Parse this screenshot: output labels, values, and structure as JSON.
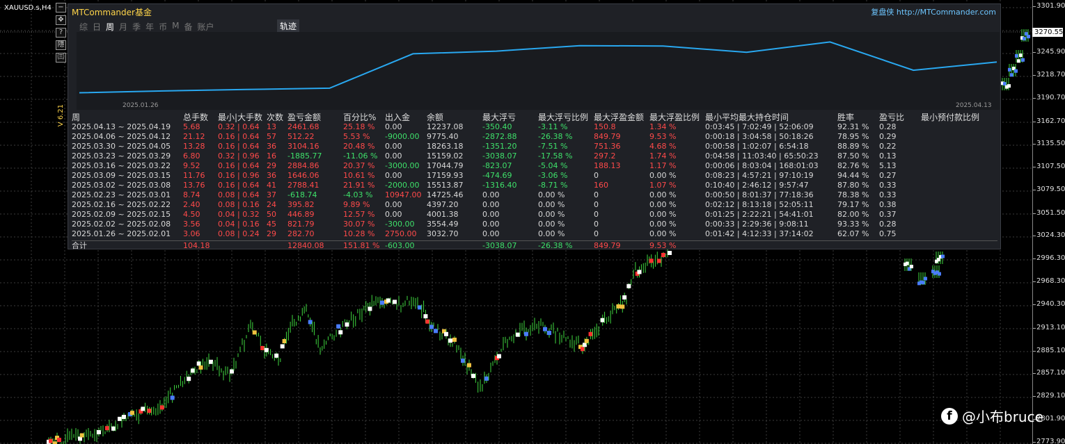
{
  "window": {
    "symbol": "XAUUSD.s,H4"
  },
  "price_axis": {
    "current_price": "3270.55",
    "ticks": [
      "3301.90",
      "3270.55",
      "3245.90",
      "3218.70",
      "3190.70",
      "3162.70",
      "3135.50",
      "3107.50",
      "3079.50",
      "3051.50",
      "3024.30",
      "2996.30",
      "2968.30",
      "2940.30",
      "2913.10",
      "2885.10",
      "2857.10",
      "2829.10",
      "2801.90",
      "2773.90"
    ]
  },
  "toolbar": {
    "buttons": [
      {
        "name": "minimize-button",
        "label": "−"
      },
      {
        "name": "move-icon",
        "label": "✥"
      },
      {
        "name": "help-button",
        "label": "?"
      },
      {
        "name": "hide-button",
        "label": "隱"
      },
      {
        "name": "restore-button",
        "label": "㈢"
      }
    ],
    "version": "V 6.21"
  },
  "panel": {
    "brand_en": "MTCommander",
    "brand_cn": "基金",
    "site_cn": "复盘侠",
    "site_url": "http://MTCommander.com",
    "tabs": [
      "综",
      "日",
      "周",
      "月",
      "季",
      "年",
      "币",
      "M",
      "备",
      "账户"
    ],
    "active_tab": 2,
    "track_tab": "轨迹",
    "equity": {
      "start_label": "2025.01.26",
      "end_label": "2025.04.13"
    }
  },
  "stats": {
    "headers": [
      "周",
      "总手数",
      "最小|大手数",
      "次数",
      "盈亏金额",
      "百分比%",
      "出入金",
      "余额",
      "最大浮亏",
      "最大浮亏比例",
      "最大浮盈金额",
      "最大浮盈比例",
      "最小平均最大持仓时间",
      "胜率",
      "盈亏比",
      "最小预付款比例"
    ],
    "rows": [
      [
        "2025.04.13 ~ 2025.04.19",
        "5.68",
        "0.32 | 0.64",
        "13",
        "2461.68",
        "25.18 %",
        "0.00",
        "12237.08",
        "-350.40",
        "-3.11 %",
        "150.8",
        "1.34 %",
        "0:03:45 | 7:02:49 | 52:06:09",
        "92.31 %",
        "0.28",
        ""
      ],
      [
        "2025.04.06 ~ 2025.04.12",
        "21.12",
        "0.16 | 0.64",
        "57",
        "512.22",
        "5.53 %",
        "-9000.00",
        "9775.40",
        "-2872.88",
        "-26.38 %",
        "849.79",
        "9.53 %",
        "0:00:18 | 3:04:58 | 50:18:26",
        "78.95 %",
        "0.29",
        ""
      ],
      [
        "2025.03.30 ~ 2025.04.05",
        "13.28",
        "0.16 | 0.64",
        "36",
        "3104.16",
        "20.48 %",
        "0.00",
        "18263.18",
        "-1351.20",
        "-7.51 %",
        "751.36",
        "4.68 %",
        "0:00:58 | 1:02:07 | 6:54:18",
        "88.89 %",
        "0.22",
        ""
      ],
      [
        "2025.03.23 ~ 2025.03.29",
        "6.80",
        "0.32 | 0.96",
        "16",
        "-1885.77",
        "-11.06 %",
        "0.00",
        "15159.02",
        "-3038.07",
        "-17.58 %",
        "297.2",
        "1.74 %",
        "0:04:58 | 11:03:40 | 65:50:23",
        "87.50 %",
        "0.13",
        ""
      ],
      [
        "2025.03.16 ~ 2025.03.22",
        "9.52",
        "0.16 | 0.64",
        "29",
        "2884.86",
        "20.37 %",
        "-3000.00",
        "17044.79",
        "-823.07",
        "-5.04 %",
        "188.13",
        "1.17 %",
        "0:00:06 | 8:03:04 | 168:01:03",
        "82.76 %",
        "5.13",
        ""
      ],
      [
        "2025.03.09 ~ 2025.03.15",
        "11.76",
        "0.16 | 0.96",
        "36",
        "1646.06",
        "10.61 %",
        "0.00",
        "17159.93",
        "-474.69",
        "-3.06 %",
        "0",
        "0.00 %",
        "0:08:23 | 4:57:21 | 97:10:19",
        "94.44 %",
        "0.27",
        ""
      ],
      [
        "2025.03.02 ~ 2025.03.08",
        "13.76",
        "0.16 | 0.64",
        "41",
        "2788.41",
        "21.91 %",
        "-2000.00",
        "15513.87",
        "-1316.40",
        "-8.71 %",
        "160",
        "1.07 %",
        "0:10:40 | 2:46:12 | 9:57:47",
        "87.80 %",
        "0.33",
        ""
      ],
      [
        "2025.02.23 ~ 2025.03.01",
        "8.74",
        "0.08 | 0.64",
        "37",
        "-618.74",
        "-4.03 %",
        "10947.00",
        "14725.46",
        "0.00",
        "0.00 %",
        "0",
        "0.00 %",
        "0:00:50 | 8:01:37 | 77:18:36",
        "78.38 %",
        "0.33",
        ""
      ],
      [
        "2025.02.16 ~ 2025.02.22",
        "2.40",
        "0.08 | 0.16",
        "24",
        "395.82",
        "9.89 %",
        "0.00",
        "4397.20",
        "0.00",
        "0.00 %",
        "0",
        "0.00 %",
        "0:02:12 | 8:13:18 | 52:05:11",
        "79.17 %",
        "0.38",
        ""
      ],
      [
        "2025.02.09 ~ 2025.02.15",
        "4.50",
        "0.04 | 0.32",
        "50",
        "446.89",
        "12.57 %",
        "0.00",
        "4001.38",
        "0.00",
        "0.00 %",
        "0",
        "0.00 %",
        "0:01:25 | 2:22:21 | 54:41:01",
        "82.00 %",
        "0.37",
        ""
      ],
      [
        "2025.02.02 ~ 2025.02.08",
        "3.56",
        "0.04 | 0.16",
        "45",
        "821.79",
        "30.07 %",
        "-300.00",
        "3554.49",
        "0.00",
        "0.00 %",
        "0",
        "0.00 %",
        "0:00:33 | 2:29:36 | 9:08:11",
        "93.33 %",
        "0.28",
        ""
      ],
      [
        "2025.01.26 ~ 2025.02.01",
        "3.06",
        "0.08 | 0.24",
        "29",
        "282.70",
        "10.28 %",
        "2750.00",
        "3032.70",
        "0.00",
        "0.00 %",
        "0",
        "0.00 %",
        "0:01:42 | 4:12:33 | 37:14:02",
        "62.07 %",
        "0.75",
        ""
      ]
    ],
    "total": [
      "合计",
      "104.18",
      "",
      "",
      "12840.08",
      "151.81 %",
      "-603.00",
      "",
      "-3038.07",
      "-26.38 %",
      "849.79",
      "9.53 %",
      "",
      "",
      "",
      ""
    ]
  },
  "watermark": {
    "icon": "facebook-icon",
    "text": "@小布bruce"
  },
  "colors": {
    "profit": "#ff4a4a",
    "loss": "#3ee06a",
    "equity_line": "#29a8f0",
    "brand": "#ffd54a",
    "link": "#6ec6ff"
  }
}
